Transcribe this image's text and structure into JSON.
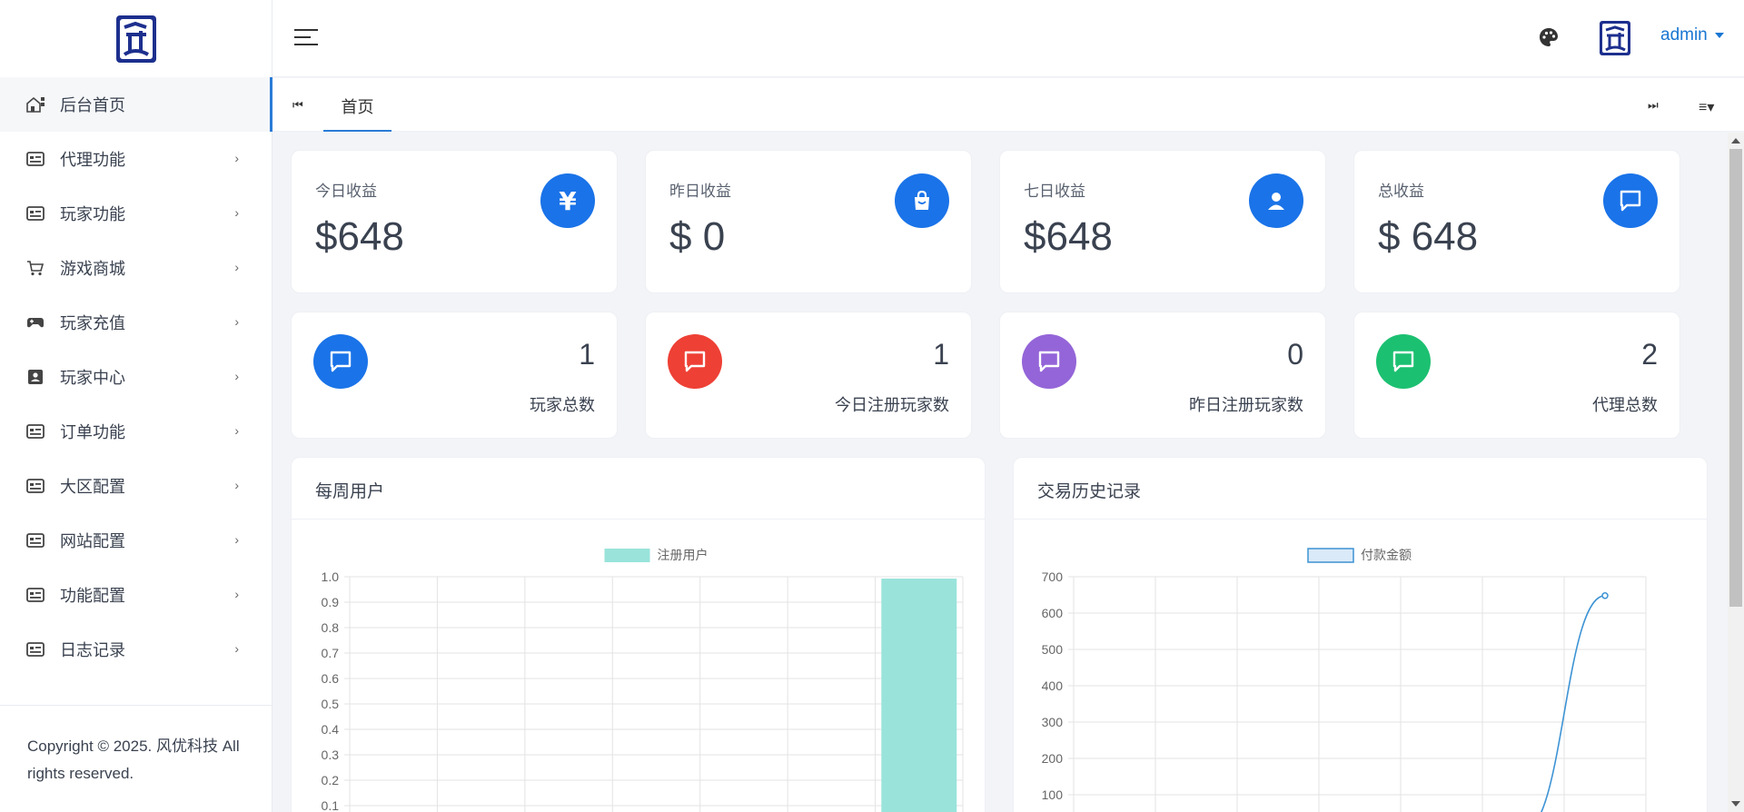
{
  "sidebar": {
    "items": [
      {
        "label": "后台首页",
        "icon": "dashboard-home-icon",
        "active": true
      },
      {
        "label": "代理功能",
        "icon": "list-card-icon"
      },
      {
        "label": "玩家功能",
        "icon": "list-card-icon"
      },
      {
        "label": "游戏商城",
        "icon": "cart-icon"
      },
      {
        "label": "玩家充值",
        "icon": "gamepad-icon"
      },
      {
        "label": "玩家中心",
        "icon": "contact-card-icon"
      },
      {
        "label": "订单功能",
        "icon": "list-card-icon"
      },
      {
        "label": "大区配置",
        "icon": "list-card-icon"
      },
      {
        "label": "网站配置",
        "icon": "list-card-icon"
      },
      {
        "label": "功能配置",
        "icon": "list-card-icon"
      },
      {
        "label": "日志记录",
        "icon": "list-card-icon"
      }
    ],
    "footer": "Copyright © 2025. 风优科技 All rights reserved."
  },
  "header": {
    "user": "admin"
  },
  "tabs": {
    "home": "首页"
  },
  "stats": [
    {
      "label": "今日收益",
      "value": "$648",
      "icon": "yen-icon"
    },
    {
      "label": "昨日收益",
      "value": "$ 0",
      "icon": "shopping-bag-icon"
    },
    {
      "label": "七日收益",
      "value": "$648",
      "icon": "user-icon"
    },
    {
      "label": "总收益",
      "value": "$ 648",
      "icon": "chat-icon"
    }
  ],
  "counts": [
    {
      "value": "1",
      "label": "玩家总数",
      "color": "#1a73e8"
    },
    {
      "value": "1",
      "label": "今日注册玩家数",
      "color": "#ee4035"
    },
    {
      "value": "0",
      "label": "昨日注册玩家数",
      "color": "#9465d8"
    },
    {
      "value": "2",
      "label": "代理总数",
      "color": "#1cc071"
    }
  ],
  "panels": {
    "weekly_title": "每周用户",
    "history_title": "交易历史记录"
  },
  "chart_data": [
    {
      "type": "bar",
      "legend": "注册用户",
      "categories": [
        "",
        "",
        "",
        "",
        "",
        "",
        ""
      ],
      "values": [
        0,
        0,
        0,
        0,
        0,
        0,
        1
      ],
      "ylim": [
        0,
        1.0
      ],
      "yticks": [
        "1.0",
        "0.9",
        "0.8",
        "0.7",
        "0.6",
        "0.5",
        "0.4",
        "0.3",
        "0.2",
        "0.1"
      ],
      "color": "#99e3db",
      "grid": true
    },
    {
      "type": "line",
      "legend": "付款金额",
      "x": [
        "",
        "",
        "",
        "",
        "",
        "",
        ""
      ],
      "values": [
        0,
        0,
        0,
        0,
        0,
        0,
        648
      ],
      "ylim": [
        0,
        700
      ],
      "yticks": [
        "700",
        "600",
        "500",
        "400",
        "300",
        "200",
        "100"
      ],
      "color": "#3d93d4",
      "fill": "#dbeaf8",
      "grid": true
    }
  ]
}
